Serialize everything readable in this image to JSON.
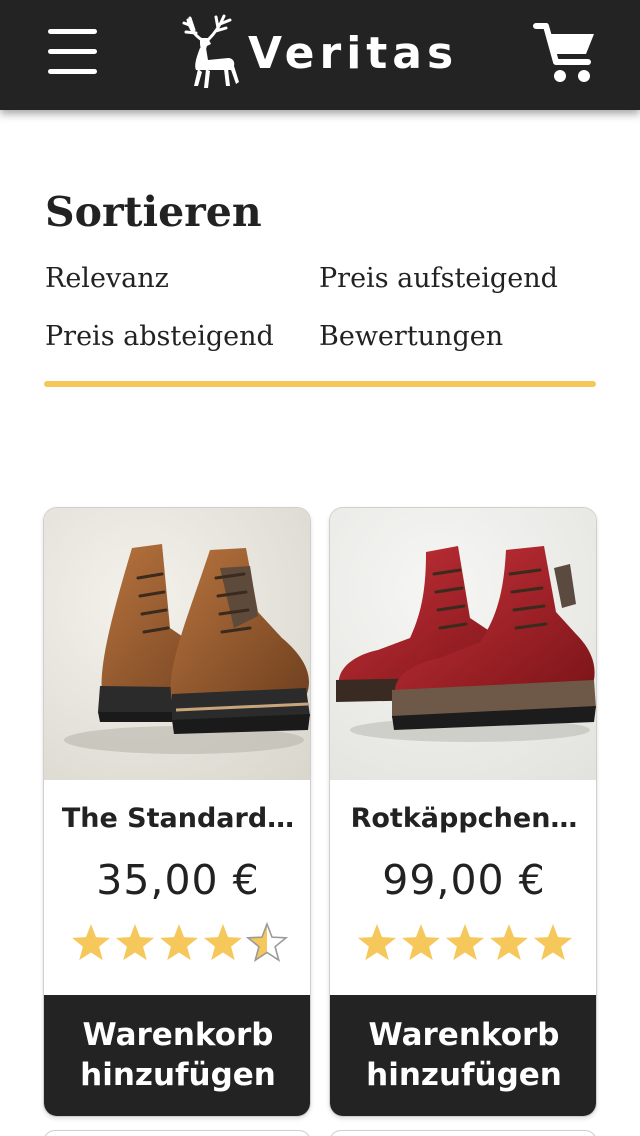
{
  "header": {
    "brand": "Veritas",
    "menu_icon": "hamburger-menu-icon",
    "logo_icon": "deer-icon",
    "cart_icon": "shopping-cart-icon",
    "background": "#232323"
  },
  "sort": {
    "title": "Sortieren",
    "options": [
      "Relevanz",
      "Preis aufsteigend",
      "Preis absteigend",
      "Bewertungen"
    ],
    "accent": "#f6c85b"
  },
  "products": [
    {
      "name": "The Standard…",
      "price": "35,00 €",
      "rating": 4.5,
      "rating_max": 5,
      "button_line1": "Warenkorb",
      "button_line2": "hinzufügen",
      "image": "brown-leather-hiking-boots",
      "color": "#8a5430"
    },
    {
      "name": "Rotkäppchen…",
      "price": "99,00 €",
      "rating": 5,
      "rating_max": 5,
      "button_line1": "Warenkorb",
      "button_line2": "hinzufügen",
      "image": "red-leather-hiking-boots",
      "color": "#a8242a"
    }
  ],
  "star_color": "#f6c85b"
}
